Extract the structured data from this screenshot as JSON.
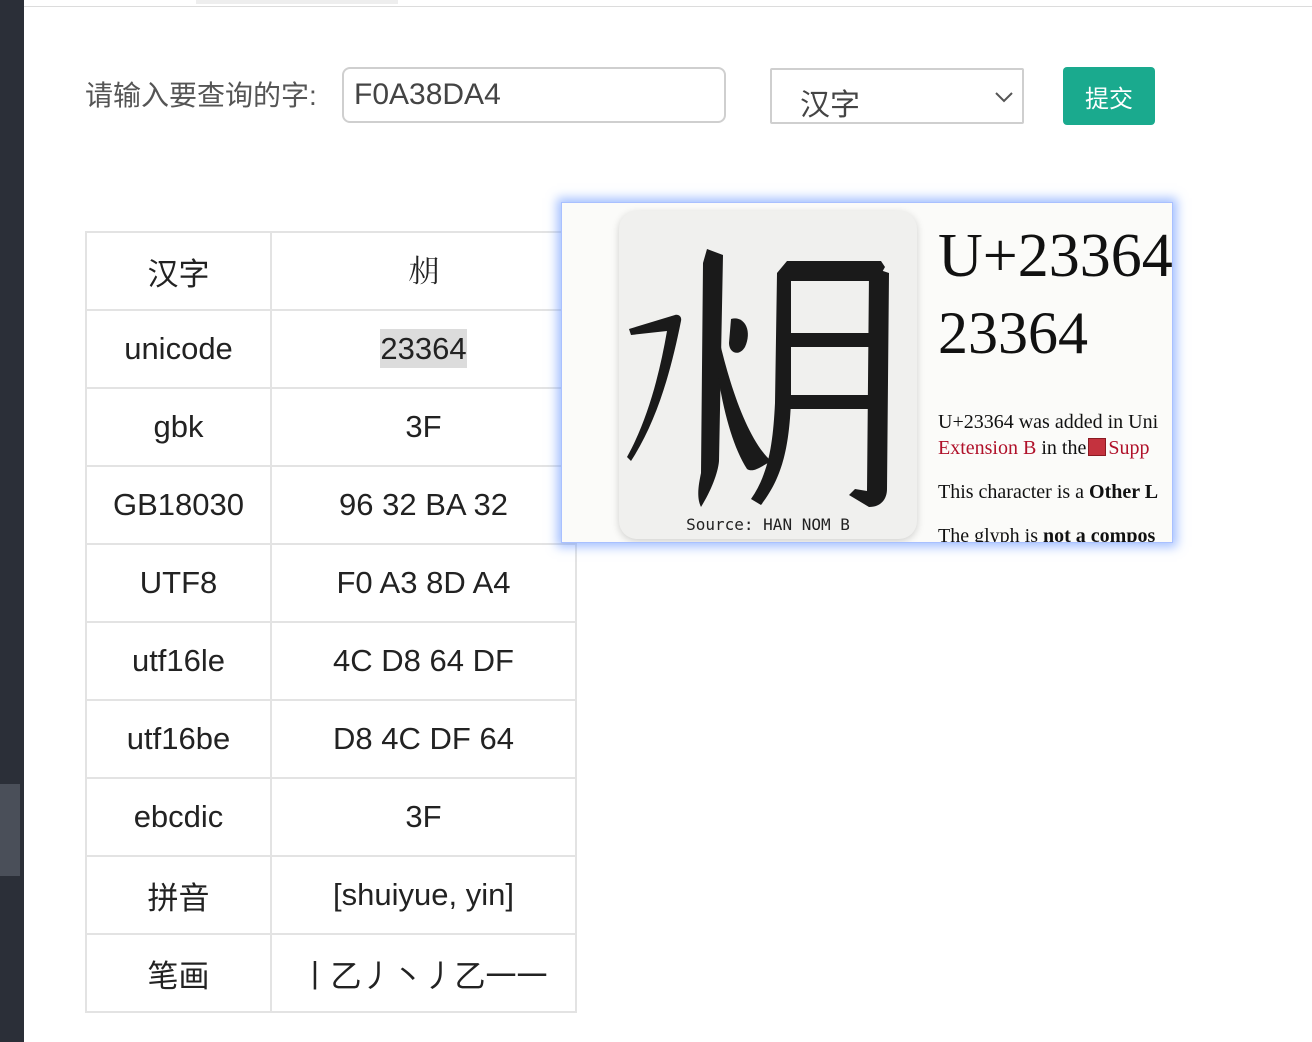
{
  "query": {
    "label": "请输入要查询的字:",
    "input_value": "F0A38DA4",
    "type_select": "汉字",
    "submit_label": "提交"
  },
  "table": {
    "rows": [
      {
        "key": "汉字",
        "value": "𣍤"
      },
      {
        "key": "unicode",
        "value": "23364"
      },
      {
        "key": "gbk",
        "value": "3F"
      },
      {
        "key": "GB18030",
        "value": "96 32 BA 32"
      },
      {
        "key": "UTF8",
        "value": "F0 A3 8D A4"
      },
      {
        "key": "utf16le",
        "value": "4C D8 64 DF"
      },
      {
        "key": "utf16be",
        "value": "D8 4C DF 64"
      },
      {
        "key": "ebcdic",
        "value": "3F"
      },
      {
        "key": "拼音",
        "value": "[shuiyue, yin]"
      },
      {
        "key": "笔画",
        "value": "丨乙丿丶丿乙一一"
      }
    ]
  },
  "popup": {
    "glyph_source": "Source: HAN NOM B",
    "codepoint_title": "U+23364",
    "codepoint_decimal": "23364",
    "line1": "U+23364 was added in Uni",
    "line2_link1": "Extension B",
    "line2_mid": "in the",
    "line2_link2": "Supp",
    "line3_prefix": "This character is a",
    "line3_bold": "Other L",
    "line4_prefix": "The glyph is",
    "line4_bold": "not a compos"
  },
  "colors": {
    "accent_button": "#1aaa8e",
    "link_red": "#b0112a",
    "popup_glow": "#5a8cff"
  }
}
